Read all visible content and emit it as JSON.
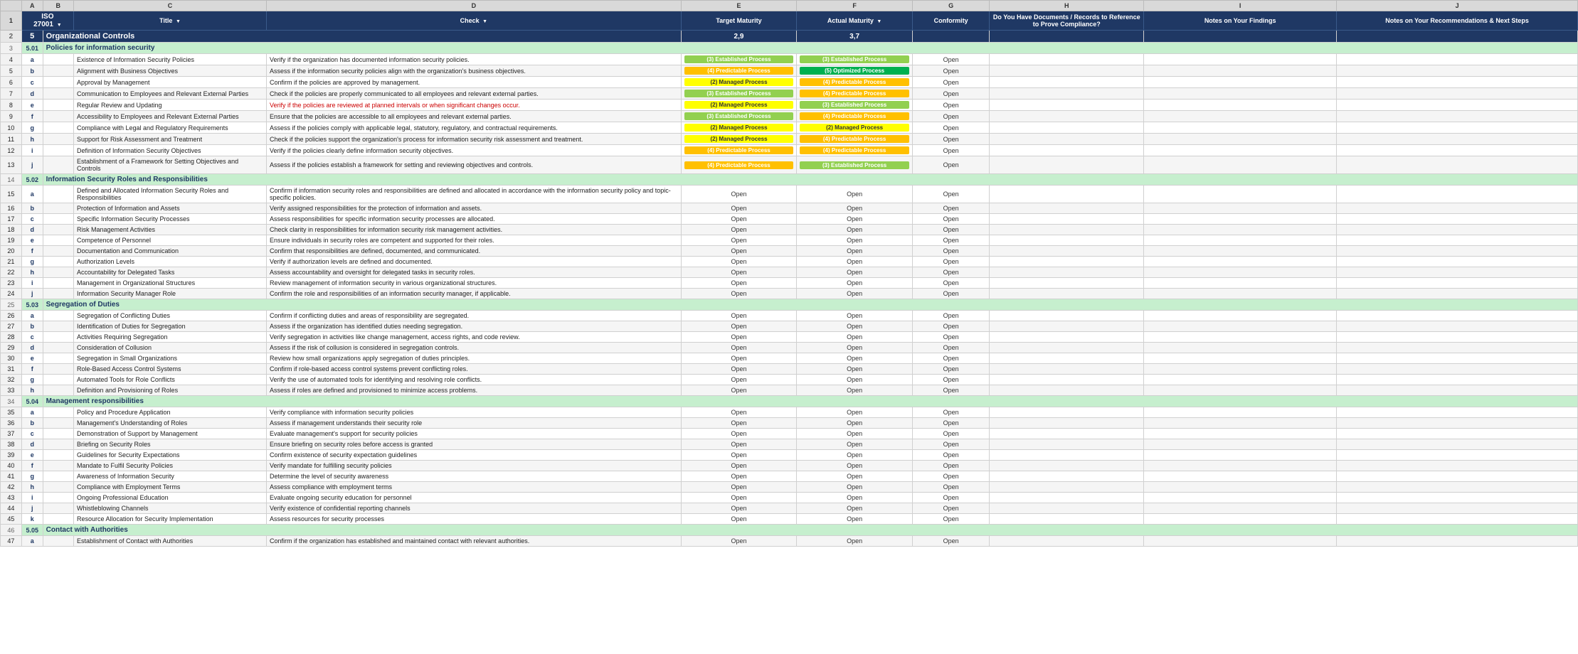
{
  "columns": {
    "letters": [
      "",
      "A",
      "B",
      "C",
      "D",
      "E",
      "F",
      "G",
      "H",
      "I",
      "J"
    ],
    "headers": {
      "iso": "ISO 27001",
      "b": "Title",
      "c": "Title",
      "d": "Check",
      "e": "Target Maturity",
      "f": "Actual Maturity",
      "g": "Conformity",
      "h": "Do You Have Documents / Records to Reference to Prove Compliance?",
      "i": "Notes on Your Findings",
      "j": "Notes on Your Recommendations & Next Steps"
    }
  },
  "summary": {
    "section": "5",
    "label": "Organizational Controls",
    "target": "2,9",
    "actual": "3,7"
  },
  "sections": [
    {
      "id": "5.01",
      "title": "Policies for information security",
      "items": [
        {
          "letter": "a",
          "title": "Existence of Information Security Policies",
          "check": "Verify if the organization has documented information security policies.",
          "target": "established",
          "target_label": "(3) Established Process",
          "actual": "established",
          "actual_label": "(3) Established Process",
          "conformity": "Open"
        },
        {
          "letter": "b",
          "title": "Alignment with Business Objectives",
          "check": "Assess if the information security policies align with the organization's business objectives.",
          "target": "predictable",
          "target_label": "(4) Predictable Process",
          "actual": "optimized",
          "actual_label": "(5) Optimized Process",
          "conformity": "Open"
        },
        {
          "letter": "c",
          "title": "Approval by Management",
          "check": "Confirm if the policies are approved by management.",
          "target": "managed",
          "target_label": "(2) Managed Process",
          "actual": "predictable",
          "actual_label": "(4) Predictable Process",
          "conformity": "Open"
        },
        {
          "letter": "d",
          "title": "Communication to Employees and Relevant External Parties",
          "check": "Check if the policies are properly communicated to all employees and relevant external parties.",
          "target": "established",
          "target_label": "(3) Established Process",
          "actual": "predictable",
          "actual_label": "(4) Predictable Process",
          "conformity": "Open"
        },
        {
          "letter": "e",
          "title": "Regular Review and Updating",
          "check": "Verify if the policies are reviewed at planned intervals or when significant changes occur.",
          "target": "managed",
          "target_label": "(2) Managed Process",
          "actual": "established",
          "actual_label": "(3) Established Process",
          "conformity": "Open"
        },
        {
          "letter": "f",
          "title": "Accessibility to Employees and Relevant External Parties",
          "check": "Ensure that the policies are accessible to all employees and relevant external parties.",
          "target": "established",
          "target_label": "(3) Established Process",
          "actual": "predictable",
          "actual_label": "(4) Predictable Process",
          "conformity": "Open"
        },
        {
          "letter": "g",
          "title": "Compliance with Legal and Regulatory Requirements",
          "check": "Assess if the policies comply with applicable legal, statutory, regulatory, and contractual requirements.",
          "target": "managed",
          "target_label": "(2) Managed Process",
          "actual": "managed",
          "actual_label": "(2) Managed Process",
          "conformity": "Open"
        },
        {
          "letter": "h",
          "title": "Support for Risk Assessment and Treatment",
          "check": "Check if the policies support the organization's process for information security risk assessment and treatment.",
          "target": "managed",
          "target_label": "(2) Managed Process",
          "actual": "predictable",
          "actual_label": "(4) Predictable Process",
          "conformity": "Open"
        },
        {
          "letter": "i",
          "title": "Definition of Information Security Objectives",
          "check": "Verify if the policies clearly define information security objectives.",
          "target": "predictable",
          "target_label": "(4) Predictable Process",
          "actual": "predictable",
          "actual_label": "(4) Predictable Process",
          "conformity": "Open"
        },
        {
          "letter": "j",
          "title": "Establishment of a Framework for Setting Objectives and Controls",
          "check": "Assess if the policies establish a framework for setting and reviewing objectives and controls.",
          "target": "predictable",
          "target_label": "(4) Predictable Process",
          "actual": "established",
          "actual_label": "(3) Established Process",
          "conformity": "Open"
        }
      ]
    },
    {
      "id": "5.02",
      "title": "Information Security Roles and Responsibilities",
      "items": [
        {
          "letter": "a",
          "title": "Defined and Allocated Information Security Roles and Responsibilities",
          "check": "Confirm if information security roles and responsibilities are defined and allocated in accordance with the information security policy and topic-specific policies.",
          "target": "Open",
          "actual": "Open",
          "conformity": "Open"
        },
        {
          "letter": "b",
          "title": "Protection of Information and Assets",
          "check": "Verify assigned responsibilities for the protection of information and assets.",
          "target": "Open",
          "actual": "Open",
          "conformity": "Open"
        },
        {
          "letter": "c",
          "title": "Specific Information Security Processes",
          "check": "Assess responsibilities for specific information security processes are allocated.",
          "target": "Open",
          "actual": "Open",
          "conformity": "Open"
        },
        {
          "letter": "d",
          "title": "Risk Management Activities",
          "check": "Check clarity in responsibilities for information security risk management activities.",
          "target": "Open",
          "actual": "Open",
          "conformity": "Open"
        },
        {
          "letter": "e",
          "title": "Competence of Personnel",
          "check": "Ensure individuals in security roles are competent and supported for their roles.",
          "target": "Open",
          "actual": "Open",
          "conformity": "Open"
        },
        {
          "letter": "f",
          "title": "Documentation and Communication",
          "check": "Confirm that responsibilities are defined, documented, and communicated.",
          "target": "Open",
          "actual": "Open",
          "conformity": "Open"
        },
        {
          "letter": "g",
          "title": "Authorization Levels",
          "check": "Verify if authorization levels are defined and documented.",
          "target": "Open",
          "actual": "Open",
          "conformity": "Open"
        },
        {
          "letter": "h",
          "title": "Accountability for Delegated Tasks",
          "check": "Assess accountability and oversight for delegated tasks in security roles.",
          "target": "Open",
          "actual": "Open",
          "conformity": "Open"
        },
        {
          "letter": "i",
          "title": "Management in Organizational Structures",
          "check": "Review management of information security in various organizational structures.",
          "target": "Open",
          "actual": "Open",
          "conformity": "Open"
        },
        {
          "letter": "j",
          "title": "Information Security Manager Role",
          "check": "Confirm the role and responsibilities of an information security manager, if applicable.",
          "target": "Open",
          "actual": "Open",
          "conformity": "Open"
        }
      ]
    },
    {
      "id": "5.03",
      "title": "Segregation of Duties",
      "items": [
        {
          "letter": "a",
          "title": "Segregation of Conflicting Duties",
          "check": "Confirm if conflicting duties and areas of responsibility are segregated.",
          "target": "Open",
          "actual": "Open",
          "conformity": "Open"
        },
        {
          "letter": "b",
          "title": "Identification of Duties for Segregation",
          "check": "Assess if the organization has identified duties needing segregation.",
          "target": "Open",
          "actual": "Open",
          "conformity": "Open"
        },
        {
          "letter": "c",
          "title": "Activities Requiring Segregation",
          "check": "Verify segregation in activities like change management, access rights, and code review.",
          "target": "Open",
          "actual": "Open",
          "conformity": "Open"
        },
        {
          "letter": "d",
          "title": "Consideration of Collusion",
          "check": "Assess if the risk of collusion is considered in segregation controls.",
          "target": "Open",
          "actual": "Open",
          "conformity": "Open"
        },
        {
          "letter": "e",
          "title": "Segregation in Small Organizations",
          "check": "Review how small organizations apply segregation of duties principles.",
          "target": "Open",
          "actual": "Open",
          "conformity": "Open"
        },
        {
          "letter": "f",
          "title": "Role-Based Access Control Systems",
          "check": "Confirm if role-based access control systems prevent conflicting roles.",
          "target": "Open",
          "actual": "Open",
          "conformity": "Open"
        },
        {
          "letter": "g",
          "title": "Automated Tools for Role Conflicts",
          "check": "Verify the use of automated tools for identifying and resolving role conflicts.",
          "target": "Open",
          "actual": "Open",
          "conformity": "Open"
        },
        {
          "letter": "h",
          "title": "Definition and Provisioning of Roles",
          "check": "Assess if roles are defined and provisioned to minimize access problems.",
          "target": "Open",
          "actual": "Open",
          "conformity": "Open"
        }
      ]
    },
    {
      "id": "5.04",
      "title": "Management responsibilities",
      "items": [
        {
          "letter": "a",
          "title": "Policy and Procedure Application",
          "check": "Verify compliance with information security policies",
          "target": "Open",
          "actual": "Open",
          "conformity": "Open"
        },
        {
          "letter": "b",
          "title": "Management's Understanding of Roles",
          "check": "Assess if management understands their security role",
          "target": "Open",
          "actual": "Open",
          "conformity": "Open"
        },
        {
          "letter": "c",
          "title": "Demonstration of Support by Management",
          "check": "Evaluate management's support for security policies",
          "target": "Open",
          "actual": "Open",
          "conformity": "Open"
        },
        {
          "letter": "d",
          "title": "Briefing on Security Roles",
          "check": "Ensure briefing on security roles before access is granted",
          "target": "Open",
          "actual": "Open",
          "conformity": "Open"
        },
        {
          "letter": "e",
          "title": "Guidelines for Security Expectations",
          "check": "Confirm existence of security expectation guidelines",
          "target": "Open",
          "actual": "Open",
          "conformity": "Open"
        },
        {
          "letter": "f",
          "title": "Mandate to Fulfil Security Policies",
          "check": "Verify mandate for fulfilling security policies",
          "target": "Open",
          "actual": "Open",
          "conformity": "Open"
        },
        {
          "letter": "g",
          "title": "Awareness of Information Security",
          "check": "Determine the level of security awareness",
          "target": "Open",
          "actual": "Open",
          "conformity": "Open"
        },
        {
          "letter": "h",
          "title": "Compliance with Employment Terms",
          "check": "Assess compliance with employment terms",
          "target": "Open",
          "actual": "Open",
          "conformity": "Open"
        },
        {
          "letter": "i",
          "title": "Ongoing Professional Education",
          "check": "Evaluate ongoing security education for personnel",
          "target": "Open",
          "actual": "Open",
          "conformity": "Open"
        },
        {
          "letter": "j",
          "title": "Whistleblowing Channels",
          "check": "Verify existence of confidential reporting channels",
          "target": "Open",
          "actual": "Open",
          "conformity": "Open"
        },
        {
          "letter": "k",
          "title": "Resource Allocation for Security Implementation",
          "check": "Assess resources for security processes",
          "target": "Open",
          "actual": "Open",
          "conformity": "Open"
        }
      ]
    },
    {
      "id": "5.05",
      "title": "Contact with Authorities",
      "items": [
        {
          "letter": "a",
          "title": "Establishment of Contact with Authorities",
          "check": "Confirm if the organization has established and maintained contact with relevant authorities.",
          "target": "Open",
          "actual": "Open",
          "conformity": "Open"
        }
      ]
    }
  ],
  "badges": {
    "established": "(3) Established Process",
    "optimized": "(5) Optimized Process",
    "managed": "(2) Managed Process",
    "predictable": "(4) Predictable Process",
    "open": "Open"
  }
}
